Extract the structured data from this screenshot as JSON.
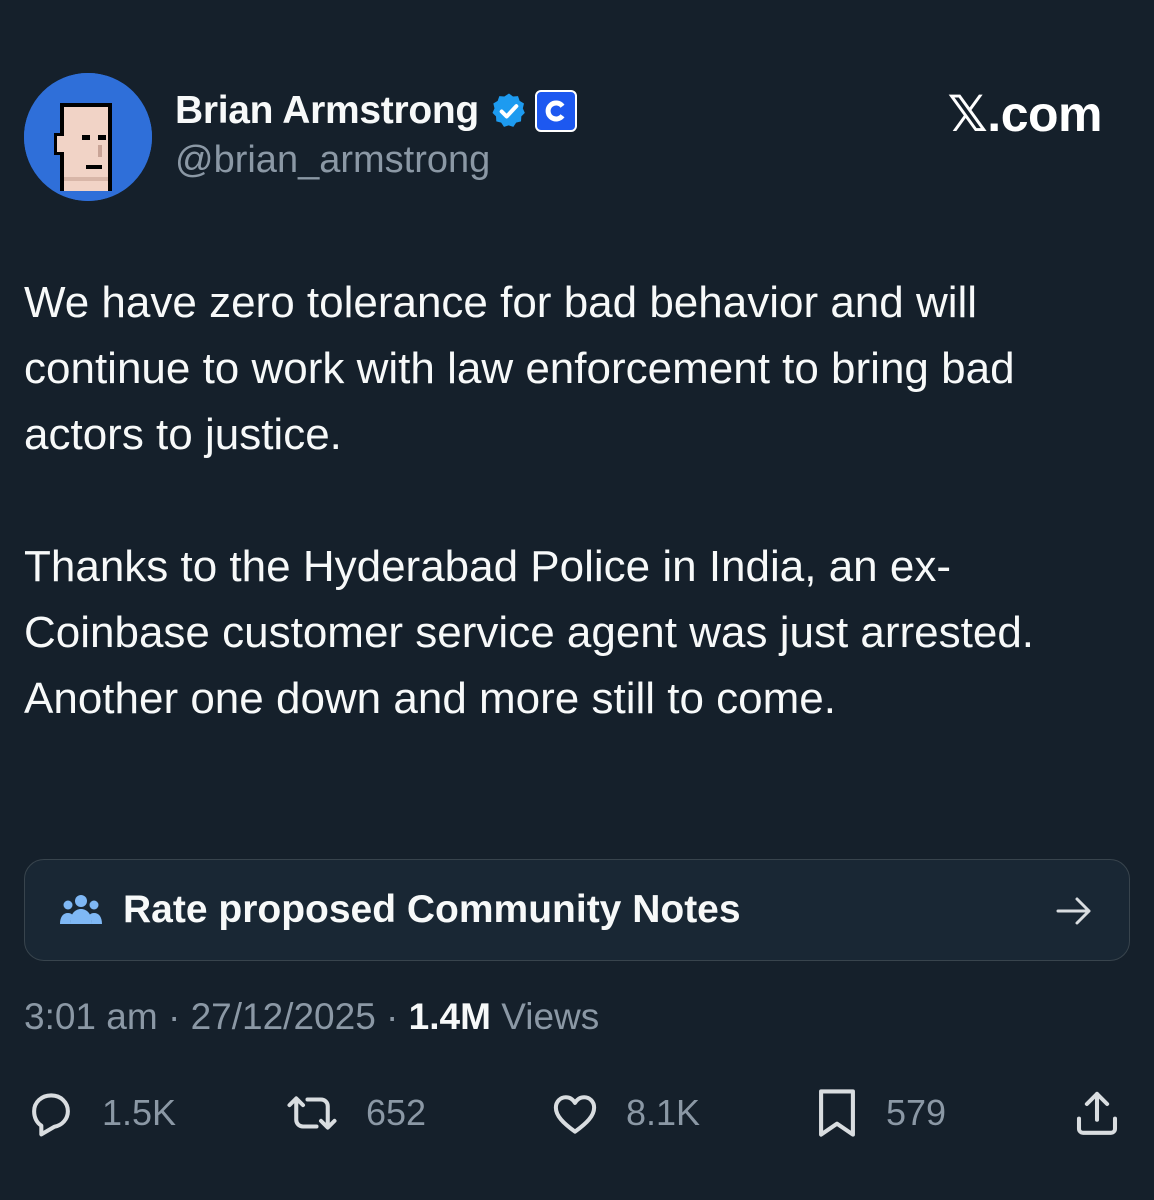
{
  "colors": {
    "background": "#15202b",
    "text_primary": "#f7f9f9",
    "text_secondary": "#8b98a5",
    "verified_blue": "#1d9bf0",
    "coinbase_blue": "#1d58f0",
    "card_border": "#38444d"
  },
  "header": {
    "avatar_icon": "pixel-punk-avatar",
    "display_name": "Brian Armstrong",
    "verified_icon": "verified-badge-icon",
    "affiliation_icon": "coinbase-logo-icon",
    "handle": "@brian_armstrong",
    "site_label": "𝕏.com"
  },
  "tweet": {
    "paragraphs": [
      "We have zero tolerance for bad behavior and will continue to work with law enforcement to bring bad actors to justice.",
      "Thanks to the Hyderabad Police in India, an ex-Coinbase customer service agent was just arrested. Another one down and more still to come."
    ]
  },
  "community_notes": {
    "icon": "people-icon",
    "label": "Rate proposed Community Notes",
    "arrow_icon": "arrow-right-icon"
  },
  "meta": {
    "time": "3:01 am",
    "separator": " · ",
    "date": "27/12/2025",
    "views_count": "1.4M",
    "views_label": " Views"
  },
  "actions": {
    "reply": {
      "icon": "reply-icon",
      "count": "1.5K"
    },
    "repost": {
      "icon": "repost-icon",
      "count": "652"
    },
    "like": {
      "icon": "heart-icon",
      "count": "8.1K"
    },
    "bookmark": {
      "icon": "bookmark-icon",
      "count": "579"
    },
    "share": {
      "icon": "share-icon"
    }
  }
}
